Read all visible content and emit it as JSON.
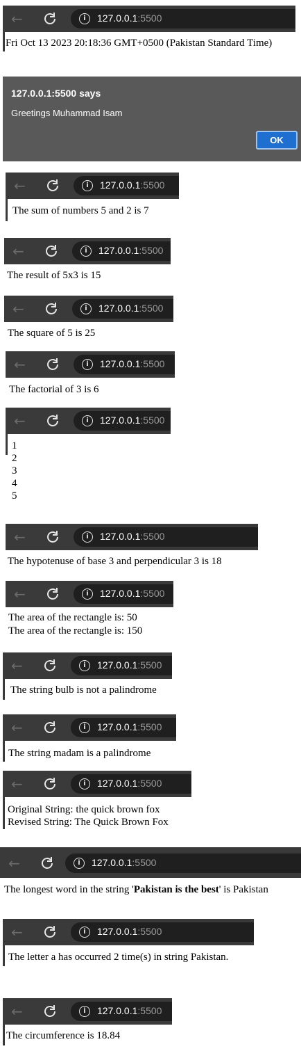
{
  "browser": {
    "host": "127.0.0.1",
    "port": ":5500"
  },
  "date_line": "Fri Oct 13 2023 20:18:36 GMT+0500 (Pakistan Standard Time)",
  "alert": {
    "title": "127.0.0.1:5500 says",
    "message": "Greetings Muhammad Isam",
    "ok_label": "OK"
  },
  "outputs": {
    "sum": "The sum of numbers 5 and 2 is 7",
    "multiply": "The result of 5x3 is 15",
    "square": "The square of 5 is 25",
    "factorial": "The factorial of 3 is 6",
    "count": [
      "1",
      "2",
      "3",
      "4",
      "5"
    ],
    "hypotenuse": "The hypotenuse of base 3 and perpendicular 3 is 18",
    "area": [
      "The area of the rectangle is: 50",
      "The area of the rectangle is: 150"
    ],
    "palindrome_bulb": "The string bulb is not a palindrome",
    "palindrome_madam": "The string madam is a palindrome",
    "title_case": [
      "Original String: the quick brown fox",
      "Revised String: The Quick Brown Fox"
    ],
    "longest_word": {
      "prefix": "The longest word in the string '",
      "bold": "Pakistan is the best",
      "suffix": "' is Pakistan"
    },
    "letter_count": "The letter a has occurred 2 time(s) in string Pakistan.",
    "circumference": "The circumference is 18.84"
  },
  "icons": {
    "back": "back-arrow-icon",
    "reload": "reload-icon",
    "info": "info-icon"
  }
}
